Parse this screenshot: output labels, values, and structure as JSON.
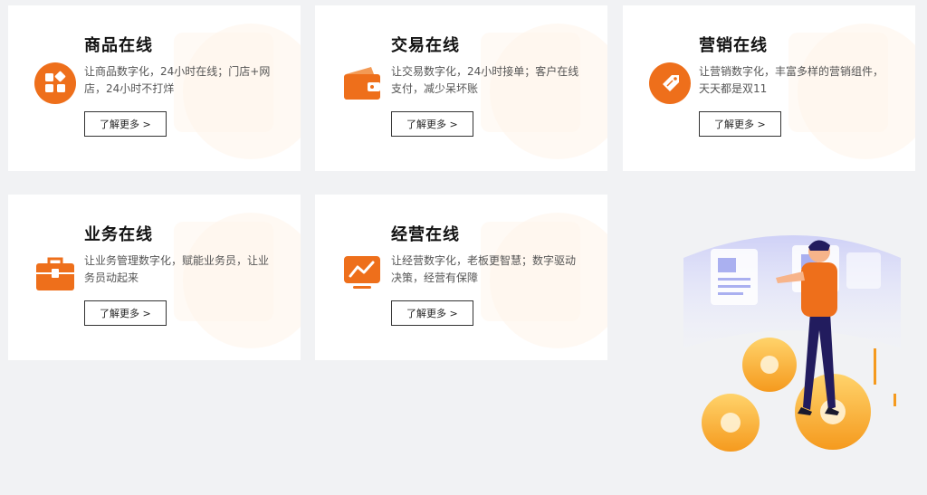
{
  "colors": {
    "accent": "#ee6f1b",
    "background": "#f1f2f4",
    "card": "#ffffff"
  },
  "cards": [
    {
      "title": "商品在线",
      "desc": "让商品数字化，24小时在线；门店+网店，24小时不打烊",
      "button": "了解更多 >",
      "icon": "product-grid-icon"
    },
    {
      "title": "交易在线",
      "desc": "让交易数字化，24小时接单；客户在线支付，减少呆坏账",
      "button": "了解更多 >",
      "icon": "wallet-icon"
    },
    {
      "title": "营销在线",
      "desc": "让营销数字化，丰富多样的营销组件，天天都是双11",
      "button": "了解更多 >",
      "icon": "price-tag-icon"
    },
    {
      "title": "业务在线",
      "desc": "让业务管理数字化，赋能业务员，让业务员动起来",
      "button": "了解更多 >",
      "icon": "briefcase-icon"
    },
    {
      "title": "经营在线",
      "desc": "让经营数字化，老板更智慧；数字驱动决策，经营有保障",
      "button": "了解更多 >",
      "icon": "trend-monitor-icon"
    }
  ]
}
